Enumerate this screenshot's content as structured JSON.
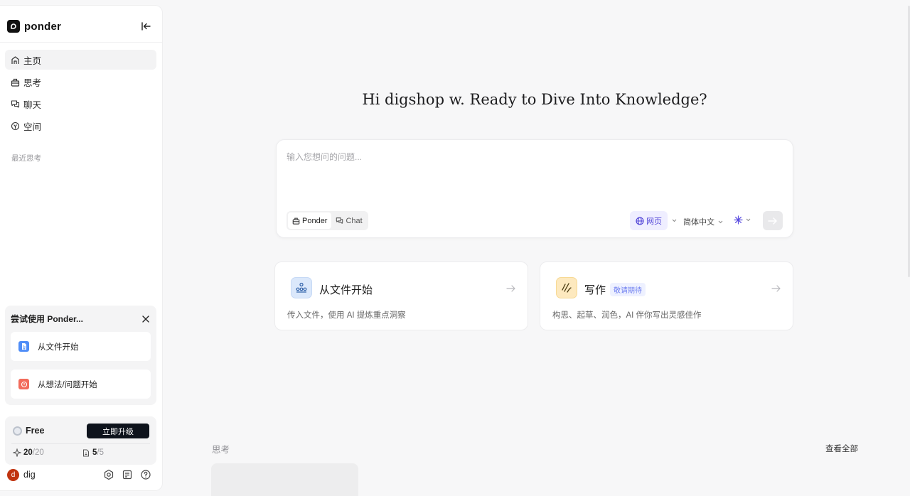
{
  "app": {
    "name": "ponder"
  },
  "sidebar": {
    "nav": [
      {
        "label": "主页",
        "icon": "home-icon",
        "active": true
      },
      {
        "label": "思考",
        "icon": "ponder-icon",
        "active": false
      },
      {
        "label": "聊天",
        "icon": "chat-icon",
        "active": false
      },
      {
        "label": "空间",
        "icon": "space-icon",
        "active": false
      }
    ],
    "recent_label": "最近思考",
    "try_panel": {
      "title": "尝试使用 Ponder...",
      "items": [
        {
          "label": "从文件开始",
          "icon": "file-icon",
          "color": "#4f8df7"
        },
        {
          "label": "从想法/问题开始",
          "icon": "idea-icon",
          "color": "#f26b5b"
        }
      ]
    },
    "plan": {
      "name": "Free",
      "upgrade_label": "立即升级",
      "credits_used": "20",
      "credits_total": "/20",
      "docs_used": "5",
      "docs_total": "/5"
    },
    "user": {
      "initial": "d",
      "name": "dig"
    }
  },
  "main": {
    "greeting": "Hi digshop w. Ready to Dive Into Knowledge?",
    "input": {
      "placeholder": "输入您想问的问题...",
      "modes": [
        "Ponder",
        "Chat"
      ],
      "active_mode": "Ponder",
      "web_label": "网页",
      "language": "简体中文"
    },
    "features": [
      {
        "title": "从文件开始",
        "badge": "",
        "desc": "传入文件，使用 AI 提炼重点洞察",
        "icon": "files-icon"
      },
      {
        "title": "写作",
        "badge": "敬请期待",
        "desc": "构思、起草、润色，AI 伴你写出灵感佳作",
        "icon": "writing-icon"
      }
    ],
    "section_title": "思考",
    "view_all": "查看全部"
  },
  "colors": {
    "accent": "#4c3fd6",
    "upgrade_bg": "#0e131c",
    "avatar": "#c0330f"
  }
}
